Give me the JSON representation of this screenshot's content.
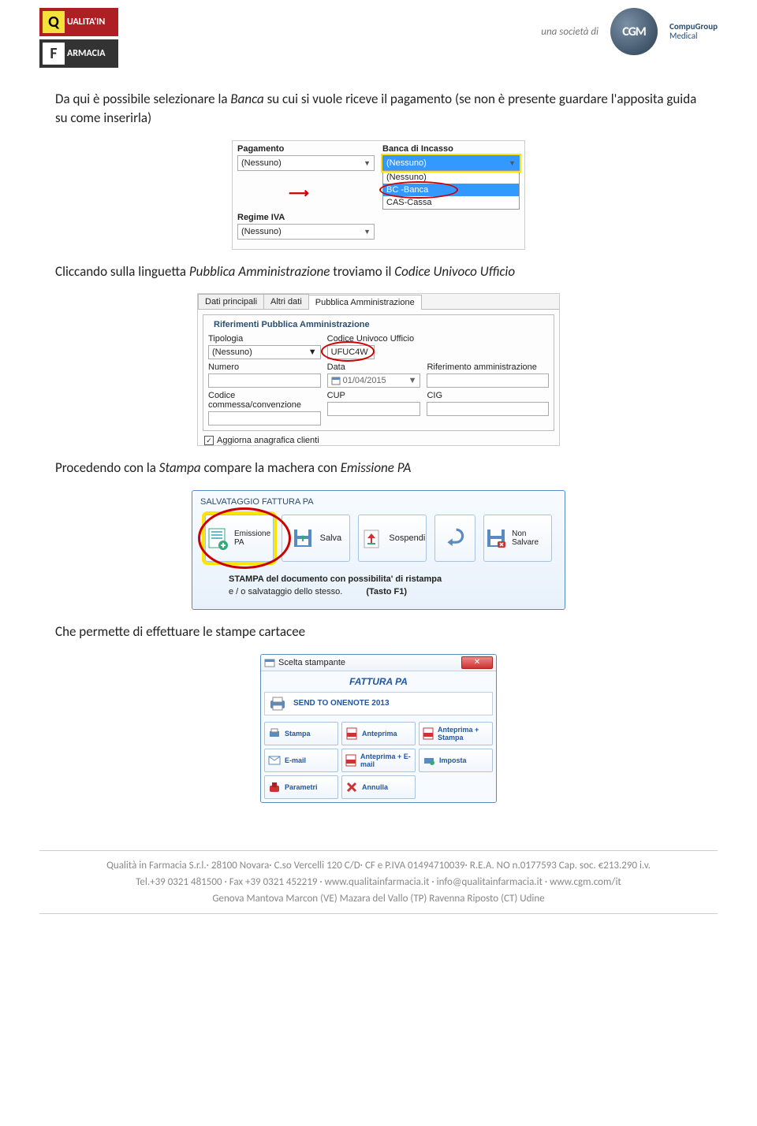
{
  "header": {
    "logo_top": "UALITA'IN",
    "logo_top_letter": "Q",
    "logo_bottom": "ARMACIA",
    "logo_bottom_letter": "F",
    "societa_label": "una società di",
    "cgm_abbr": "CGM",
    "cgm_name_bold": "CompuGroup",
    "cgm_name_reg": "Medical"
  },
  "para1_pre": "Da qui è possibile selezionare la ",
  "para1_em": "Banca",
  "para1_post": " su cui si vuole riceve il pagamento (se non è presente guardare l'apposita guida su come inserirla)",
  "panel1": {
    "pagamento_label": "Pagamento",
    "pagamento_value": "(Nessuno)",
    "banca_label": "Banca di Incasso",
    "banca_value": "(Nessuno)",
    "regime_label": "Regime IVA",
    "regime_value": "(Nessuno)",
    "opt_nessuno": "(Nessuno)",
    "opt_bc": "BC -Banca",
    "opt_cas": "CAS-Cassa"
  },
  "para2_pre": "Cliccando sulla linguetta ",
  "para2_em": "Pubblica Amministrazione",
  "para2_mid": " troviamo il ",
  "para2_em2": "Codice Univoco Ufficio",
  "panel2": {
    "tab1": "Dati principali",
    "tab2": "Altri dati",
    "tab3": "Pubblica Amministrazione",
    "legend": "Riferimenti Pubblica Amministrazione",
    "tipologia": "Tipologia",
    "tipologia_val": "(Nessuno)",
    "codice_uff": "Codice Univoco Ufficio",
    "codice_uff_val": "UFUC4W",
    "numero": "Numero",
    "data": "Data",
    "data_val": "01/04/2015",
    "rif_amm": "Riferimento amministrazione",
    "commessa": "Codice commessa/convenzione",
    "cup": "CUP",
    "cig": "CIG",
    "aggiorna": "Aggiorna anagrafica clienti"
  },
  "para3_pre": "Procedendo con la ",
  "para3_em": "Stampa",
  "para3_mid": " compare la machera con ",
  "para3_em2": "Emissione PA",
  "panel3": {
    "title": "SALVATAGGIO FATTURA PA",
    "btn_emissione": "Emissione PA",
    "btn_salva": "Salva",
    "btn_sospendi": "Sospendi",
    "btn_nonsalvare": "Non Salvare",
    "desc": "STAMPA del documento con possibilita' di ristampa",
    "sub1": "e / o salvataggio dello stesso.",
    "sub2": "(Tasto F1)"
  },
  "para4": "Che permette di effettuare le stampe cartacee",
  "panel4": {
    "titlebar": "Scelta stampante",
    "heading": "FATTURA PA",
    "printer": "SEND TO ONENOTE 2013",
    "stampa": "Stampa",
    "anteprima": "Anteprima",
    "anteprima_stampa": "Anteprima + Stampa",
    "email": "E-mail",
    "anteprima_email": "Anteprima + E-mail",
    "imposta": "Imposta",
    "parametri": "Parametri",
    "annulla": "Annulla"
  },
  "footer": {
    "line1": "Qualità in Farmacia S.r.l.· 28100 Novara· C.so Vercelli 120 C/D· CF e P.IVA 01494710039· R.E.A. NO n.0177593 Cap. soc. €213.290 i.v.",
    "line2": "Tel.+39 0321 481500 · Fax +39 0321 452219 · www.qualitainfarmacia.it · info@qualitainfarmacia.it · www.cgm.com/it",
    "line3": "Genova    Mantova    Marcon (VE)  Mazara del Vallo (TP)   Ravenna    Riposto (CT)   Udine"
  }
}
